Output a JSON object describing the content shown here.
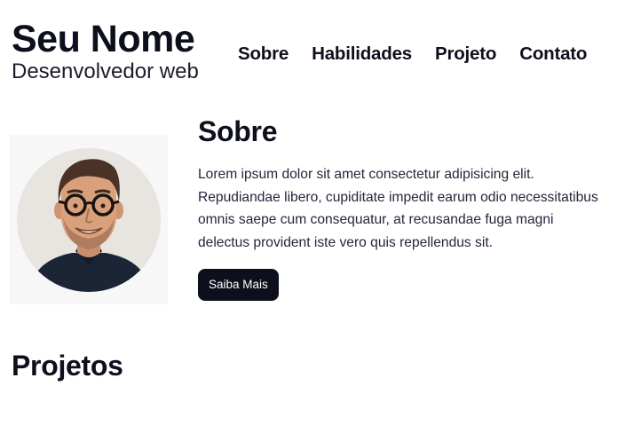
{
  "header": {
    "name": "Seu Nome",
    "role": "Desenvolvedor web"
  },
  "nav": {
    "items": [
      "Sobre",
      "Habilidades",
      "Projeto",
      "Contato"
    ]
  },
  "about": {
    "title": "Sobre",
    "text": "Lorem ipsum dolor sit amet consectetur adipisicing elit. Repudiandae libero, cupiditate impedit earum odio necessitatibus omnis saepe cum consequatur, at recusandae fuga magni delectus provident iste vero quis repellendus sit.",
    "button_label": "Saiba Mais"
  },
  "projects": {
    "title": "Projetos"
  },
  "colors": {
    "text": "#0d0f1c",
    "button_bg": "#0d0f1c",
    "button_text": "#ffffff",
    "background": "#ffffff"
  }
}
